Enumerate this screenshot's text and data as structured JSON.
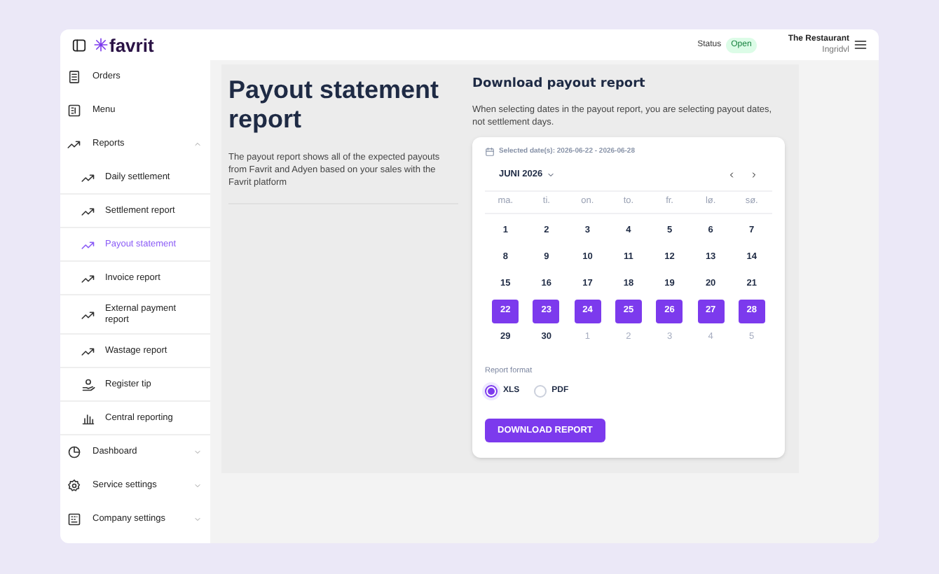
{
  "header": {
    "brand": "favrit",
    "status_label": "Status",
    "status": "Open",
    "restaurant": "The Restaurant",
    "user": "Ingridvl"
  },
  "sidebar": {
    "items": [
      {
        "label": "Orders",
        "kind": "link"
      },
      {
        "label": "Menu",
        "kind": "link"
      },
      {
        "label": "Reports",
        "kind": "group",
        "expanded": true,
        "children": [
          {
            "label": "Daily settlement",
            "selected": false
          },
          {
            "label": "Settlement report",
            "selected": false
          },
          {
            "label": "Payout statement",
            "selected": true
          },
          {
            "label": "Invoice report",
            "selected": false
          },
          {
            "label": "External payment report",
            "selected": false
          },
          {
            "label": "Wastage report",
            "selected": false
          },
          {
            "label": "Register tip",
            "selected": false
          },
          {
            "label": "Central reporting",
            "selected": false
          }
        ]
      },
      {
        "label": "Dashboard",
        "kind": "group",
        "expanded": false
      },
      {
        "label": "Service settings",
        "kind": "group",
        "expanded": false
      },
      {
        "label": "Company settings",
        "kind": "group",
        "expanded": false
      }
    ]
  },
  "intro": {
    "title": "Payout statement report",
    "text": "The payout report shows all of the expected payouts from Favrit and Adyen based on your sales with the Favrit platform"
  },
  "download": {
    "title": "Download payout report",
    "text": "When selecting dates in the payout report, you are selecting payout dates, not settlement days.",
    "selected_dates": "Selected date(s): 2026-06-22 - 2026-06-28",
    "month": "JUNI 2026",
    "weekdays": [
      "ma.",
      "ti.",
      "on.",
      "to.",
      "fr.",
      "lø.",
      "sø."
    ],
    "days": [
      {
        "label": "1",
        "selected": false,
        "outside": false
      },
      {
        "label": "2",
        "selected": false,
        "outside": false
      },
      {
        "label": "3",
        "selected": false,
        "outside": false
      },
      {
        "label": "4",
        "selected": false,
        "outside": false
      },
      {
        "label": "5",
        "selected": false,
        "outside": false
      },
      {
        "label": "6",
        "selected": false,
        "outside": false
      },
      {
        "label": "7",
        "selected": false,
        "outside": false
      },
      {
        "label": "8",
        "selected": false,
        "outside": false
      },
      {
        "label": "9",
        "selected": false,
        "outside": false
      },
      {
        "label": "10",
        "selected": false,
        "outside": false
      },
      {
        "label": "11",
        "selected": false,
        "outside": false
      },
      {
        "label": "12",
        "selected": false,
        "outside": false
      },
      {
        "label": "13",
        "selected": false,
        "outside": false
      },
      {
        "label": "14",
        "selected": false,
        "outside": false
      },
      {
        "label": "15",
        "selected": false,
        "outside": false
      },
      {
        "label": "16",
        "selected": false,
        "outside": false
      },
      {
        "label": "17",
        "selected": false,
        "outside": false
      },
      {
        "label": "18",
        "selected": false,
        "outside": false
      },
      {
        "label": "19",
        "selected": false,
        "outside": false
      },
      {
        "label": "20",
        "selected": false,
        "outside": false
      },
      {
        "label": "21",
        "selected": false,
        "outside": false
      },
      {
        "label": "22",
        "selected": true,
        "outside": false
      },
      {
        "label": "23",
        "selected": true,
        "outside": false
      },
      {
        "label": "24",
        "selected": true,
        "outside": false
      },
      {
        "label": "25",
        "selected": true,
        "outside": false
      },
      {
        "label": "26",
        "selected": true,
        "outside": false
      },
      {
        "label": "27",
        "selected": true,
        "outside": false
      },
      {
        "label": "28",
        "selected": true,
        "outside": false
      },
      {
        "label": "29",
        "selected": false,
        "outside": false
      },
      {
        "label": "30",
        "selected": false,
        "outside": false
      },
      {
        "label": "1",
        "selected": false,
        "outside": true
      },
      {
        "label": "2",
        "selected": false,
        "outside": true
      },
      {
        "label": "3",
        "selected": false,
        "outside": true
      },
      {
        "label": "4",
        "selected": false,
        "outside": true
      },
      {
        "label": "5",
        "selected": false,
        "outside": true
      }
    ],
    "format_label": "Report format",
    "formats": [
      {
        "label": "XLS",
        "selected": true
      },
      {
        "label": "PDF",
        "selected": false
      }
    ],
    "button": "DOWNLOAD REPORT"
  }
}
